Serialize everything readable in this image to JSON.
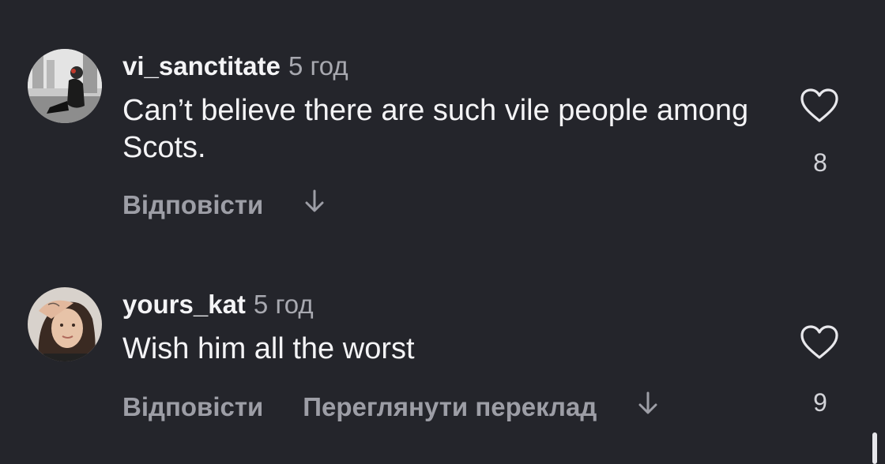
{
  "comments": [
    {
      "username": "vi_sanctitate",
      "time": "5 год",
      "text": "Can’t believe there are such vile people among Scots.",
      "reply_label": "Відповісти",
      "likes": "8",
      "avatar_icon": "user-avatar-icon"
    },
    {
      "username": "yours_kat",
      "time": "5 год",
      "text": "Wish him all the worst",
      "reply_label": "Відповісти",
      "translate_label": "Переглянути переклад",
      "likes": "9",
      "avatar_icon": "user-avatar-icon"
    }
  ],
  "colors": {
    "background": "#24252b",
    "primary_text": "#f4f4f6",
    "secondary_text": "#9d9ea6"
  },
  "icons": {
    "like": "heart-outline-icon",
    "expand": "arrow-down-icon"
  }
}
